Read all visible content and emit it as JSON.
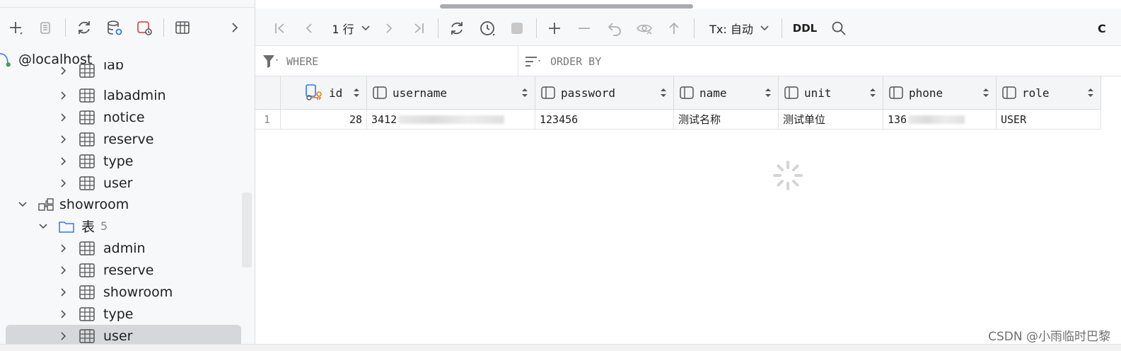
{
  "left_toolbar": {
    "icons": [
      "add-icon",
      "copy-icon",
      "refresh-icon",
      "database-settings-icon",
      "database-delete-icon",
      "table-icon",
      "chevron-right-icon"
    ]
  },
  "tree": {
    "host": "@localhost",
    "partial_item": "lab",
    "items_db1": [
      "labadmin",
      "notice",
      "reserve",
      "type",
      "user"
    ],
    "db2": "showroom",
    "folder_label": "表",
    "folder_count": "5",
    "items_db2": [
      "admin",
      "reserve",
      "showroom",
      "type",
      "user"
    ]
  },
  "toolbar": {
    "rows_label": "1 行",
    "tx_label": "Tx: 自动",
    "ddl_label": "DDL",
    "trailing_text": "C"
  },
  "filters": {
    "where": "WHERE",
    "order_by": "ORDER BY"
  },
  "grid": {
    "columns": [
      "id",
      "username",
      "password",
      "name",
      "unit",
      "phone",
      "role"
    ],
    "row_number": "1",
    "row": {
      "id": "28",
      "username": "3412",
      "password": "123456",
      "name": "测试名称",
      "unit": "测试单位",
      "phone": "136",
      "role": "USER"
    }
  },
  "watermark": "CSDN @小雨临时巴黎",
  "colors": {
    "accent_orange": "#e67e22",
    "icon_blue": "#3574f0",
    "selection_gray": "#d6d7db"
  }
}
